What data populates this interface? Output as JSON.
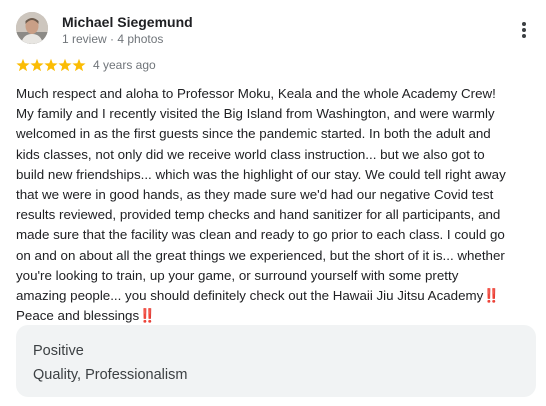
{
  "review": {
    "author": {
      "name": "Michael Siegemund",
      "meta": "1 review · 4 photos"
    },
    "rating": 5,
    "rating_max": 5,
    "star_color": "#fbbc04",
    "date": "4 years ago",
    "more_icon": "more-vert-icon",
    "text_lines": [
      "Much respect and aloha to Professor Moku, Keala and the whole Academy Crew!",
      "My family and I recently visited the Big Island from Washington, and were warmly",
      "welcomed in as the first guests since the pandemic started. In both the adult and",
      "kids classes, not only did we receive world class instruction... but we also got to",
      "build new friendships... which was the highlight of our stay. We could tell right away",
      "that we were in good hands, as they made sure we'd had our negative Covid test",
      "results reviewed, provided temp checks and hand sanitizer for all participants, and",
      "made sure that the facility was clean and ready to go prior to each class. I could go",
      "on and on about all the great things we experienced, but the short of it is... whether",
      "you're looking to train, up your game, or surround yourself with some pretty",
      "amazing people... you should definitely check out the Hawaii Jiu Jitsu Academy‼️",
      "Peace and blessings‼️"
    ]
  },
  "attributes": {
    "label": "Positive",
    "value": "Quality, Professionalism",
    "background": "#f1f3f4"
  }
}
